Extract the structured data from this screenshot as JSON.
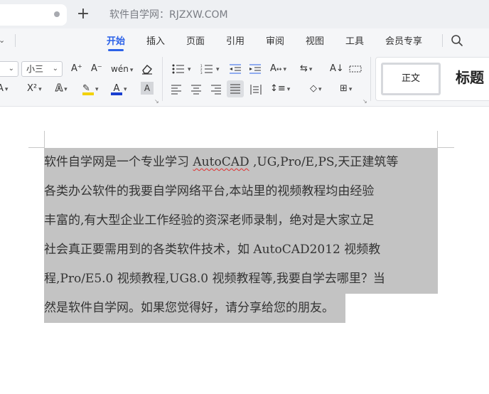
{
  "window": {
    "title": "软件自学网：RJZXW.COM",
    "new_tab_symbol": "+"
  },
  "ribbon": {
    "tabs": [
      {
        "label": "开始",
        "active": true
      },
      {
        "label": "插入",
        "active": false
      },
      {
        "label": "页面",
        "active": false
      },
      {
        "label": "引用",
        "active": false
      },
      {
        "label": "审阅",
        "active": false
      },
      {
        "label": "视图",
        "active": false
      },
      {
        "label": "工具",
        "active": false
      },
      {
        "label": "会员专享",
        "active": false
      }
    ],
    "accent_color": "#2c62e8"
  },
  "toolbar": {
    "font_size_value": "小三",
    "grow_font": "A⁺",
    "shrink_font": "A⁻",
    "phonetic": "wén",
    "superscript": "X²",
    "font_color_letter": "A",
    "highlight_color": "#f2d200",
    "font_color": "#1a3fd0",
    "char_shading": "A",
    "styles": {
      "normal": "正文",
      "heading": "标题"
    }
  },
  "document": {
    "lines": [
      {
        "text_a": "软件自学网是一个专业学习 ",
        "text_b": "AutoCAD",
        "text_c": " ,UG,Pro/E,PS,天正建筑等"
      },
      {
        "text_a": "各类办公软件的我要自学网络平台,本站里的视频教程均由经验"
      },
      {
        "text_a": "丰富的,有大型企业工作经验的资深老师录制，绝对是大家立足"
      },
      {
        "text_a": "社会真正要需用到的各类软件技术，如 AutoCAD2012 视频教"
      },
      {
        "text_a": "程,Pro/E5.0 视频教程,UG8.0 视频教程等,我要自学去哪里？当"
      },
      {
        "text_a": "然是软件自学网。如果您觉得好，请分享给您的朋友。"
      }
    ],
    "selection_color": "#c3c3c3"
  }
}
